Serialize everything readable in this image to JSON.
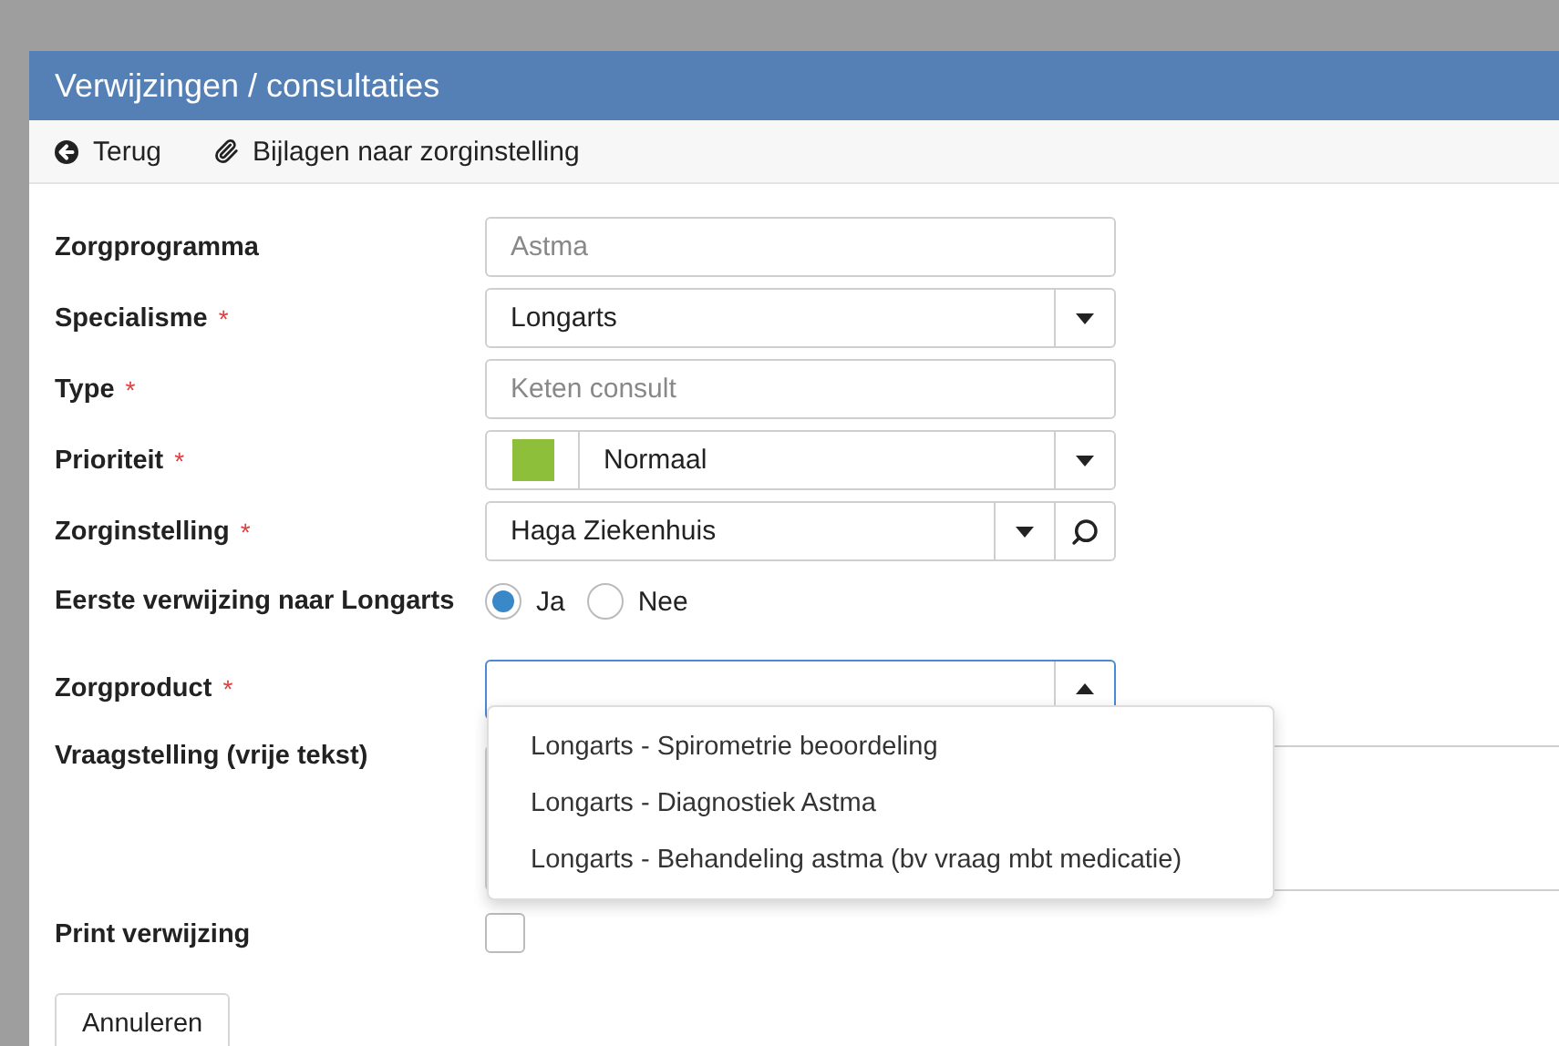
{
  "window": {
    "title": "Verwijzingen / consultaties"
  },
  "toolbar": [
    {
      "kind": "back",
      "label": "Terug"
    },
    {
      "kind": "attachment",
      "label": "Bijlagen naar zorginstelling"
    }
  ],
  "fields": [
    {
      "kind": "readonly",
      "label": "Zorgprogramma",
      "placeholder": "Astma"
    },
    {
      "kind": "select",
      "label": "Specialisme",
      "marker": "*",
      "value": "Longarts"
    },
    {
      "kind": "readonly",
      "label": "Type",
      "marker": "*",
      "placeholder": "Keten consult"
    },
    {
      "kind": "color-select",
      "label": "Prioriteit",
      "marker": "*",
      "value": "Normaal",
      "color": "#8dbf3a"
    },
    {
      "kind": "search-select",
      "label": "Zorginstelling",
      "marker": "*",
      "value": "Haga Ziekenhuis"
    },
    {
      "kind": "radio",
      "label": "Eerste verwijzing naar Longarts",
      "options": [
        {
          "label": "Ja",
          "selected": true
        },
        {
          "label": "Nee",
          "selected": false
        }
      ]
    },
    {
      "kind": "combo",
      "label": "Zorgproduct",
      "marker": "*",
      "expanded": true,
      "options": [
        "Longarts - Spirometrie beoordeling",
        "Longarts - Diagnostiek Astma",
        "Longarts - Behandeling astma (bv vraag mbt medicatie)"
      ]
    },
    {
      "kind": "textarea",
      "label": "Vraagstelling (vrije tekst)"
    },
    {
      "kind": "checkbox",
      "label": "Print verwijzing",
      "checked": false
    }
  ],
  "buttons": [
    "Annuleren"
  ]
}
